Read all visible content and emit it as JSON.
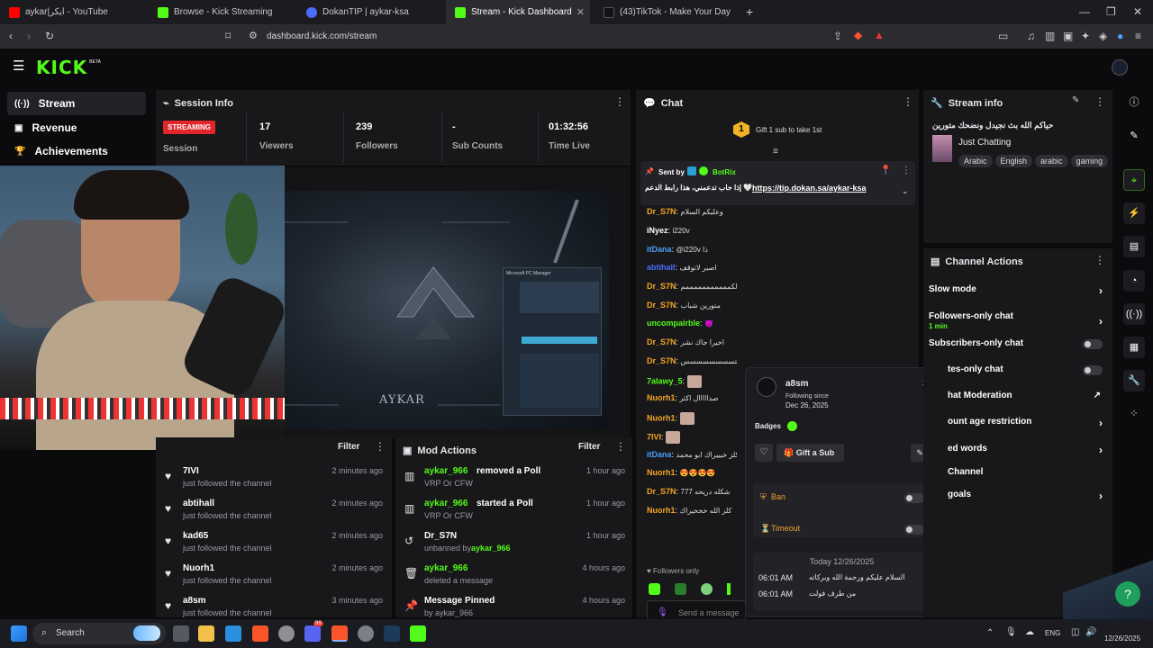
{
  "browser": {
    "tabs": [
      {
        "label": "aykar|ايكر - YouTube",
        "color": "#ff0000"
      },
      {
        "label": "Browse - Kick Streaming",
        "color": "#53fc18"
      },
      {
        "label": "DokanTIP | aykar-ksa",
        "color": "#4a6cf7"
      },
      {
        "label": "Stream - Kick Dashboard",
        "color": "#53fc18"
      },
      {
        "label": "(43)TikTok - Make Your Day",
        "color": "#111111"
      }
    ],
    "new_tab": "+",
    "url": "dashboard.kick.com/stream"
  },
  "brand": {
    "logo": "KICK",
    "badge": "BETA",
    "accent": "#53fc18"
  },
  "nav": [
    {
      "label": "Stream",
      "icon": "stream-icon"
    },
    {
      "label": "Revenue",
      "icon": "revenue-icon"
    },
    {
      "label": "Achievements",
      "icon": "trophy-icon"
    }
  ],
  "session": {
    "title": "Session Info",
    "status": "STREAMING",
    "status_label": "Session",
    "stats": [
      {
        "value": "17",
        "label": "Viewers"
      },
      {
        "value": "239",
        "label": "Followers"
      },
      {
        "value": "-",
        "label": "Sub Counts"
      },
      {
        "value": "01:32:56",
        "label": "Time Live"
      }
    ]
  },
  "preview": {
    "watermark": "AYKAR",
    "window_title": "Microsoft PC Manager"
  },
  "activity": {
    "filter": "Filter",
    "events": [
      {
        "name": "7IVI",
        "sub": "just followed the channel",
        "time": "2 minutes ago"
      },
      {
        "name": "abtihall",
        "sub": "just followed the channel",
        "time": "2 minutes ago"
      },
      {
        "name": "kad65",
        "sub": "just followed the channel",
        "time": "2 minutes ago"
      },
      {
        "name": "Nuorh1",
        "sub": "just followed the channel",
        "time": "2 minutes ago"
      },
      {
        "name": "a8sm",
        "sub": "just followed the channel",
        "time": "3 minutes ago"
      }
    ]
  },
  "mod_actions": {
    "title": "Mod Actions",
    "filter": "Filter",
    "items": [
      {
        "user": "aykar_966",
        "action": "removed a Poll",
        "sub": "VRP Or CFW",
        "time": "1 hour ago"
      },
      {
        "user": "aykar_966",
        "action": "started a Poll",
        "sub": "VRP Or CFW",
        "time": "1 hour ago"
      },
      {
        "user": "Dr_S7N",
        "action": "",
        "sub": "unbanned by",
        "by": "aykar_966",
        "time": "1 hour ago"
      },
      {
        "user": "aykar_966",
        "action": "",
        "sub": "deleted a message",
        "time": "4 hours ago"
      },
      {
        "user": "Message Pinned",
        "action": "",
        "sub": "by aykar_966",
        "time": "4 hours ago"
      }
    ]
  },
  "chat": {
    "title": "Chat",
    "gift_rank": "1",
    "gift_text": "Gift 1 sub to take 1st",
    "pinned_sender_prefix": "Sent by",
    "pinned_sender": "BotRix",
    "pinned_text": "إذا حاب تدعمني، هذا رابط الدعم 🤍",
    "pinned_link": "https://tip.dokan.sa/aykar-ksa",
    "messages": [
      {
        "user": "Dr_S7N",
        "text": "وعليكم السلام",
        "color": "#f5a623"
      },
      {
        "user": "iNyez",
        "text": "i220v",
        "color": "#ffffff"
      },
      {
        "user": "itDana",
        "text": "@i220v ذا",
        "color": "#4a9ff5"
      },
      {
        "user": "abtihall",
        "text": "اصبر لاتوقف",
        "color": "#4a6cf7"
      },
      {
        "user": "Dr_S7N",
        "text": "والكمممممممممممم",
        "color": "#f5a623"
      },
      {
        "user": "Dr_S7N",
        "text": "متورين شباب",
        "color": "#f5a623"
      },
      {
        "user": "uncompairble",
        "text": "😈",
        "color": "#53fc18"
      },
      {
        "user": "Dr_S7N",
        "text": "اخيرا جاك نشر",
        "color": "#f5a623"
      },
      {
        "user": "Dr_S7N",
        "text": "دوبيتسسسسسسسس",
        "color": "#f5a623"
      },
      {
        "user": "7alawy_5",
        "text": "",
        "color": "#53fc18"
      },
      {
        "user": "Nuorh1",
        "text": "صدااااال اكثر",
        "color": "#f5a623"
      },
      {
        "user": "Nuorh1",
        "text": "",
        "color": "#f5a623"
      },
      {
        "user": "7IVI",
        "text": "",
        "color": "#f5a623"
      },
      {
        "user": "itDana",
        "text": "كلز خبييراك ابو محمد",
        "color": "#4a9ff5"
      },
      {
        "user": "Nuorh1",
        "text": "😍😍😍😍",
        "color": "#f5a623"
      },
      {
        "user": "Dr_S7N",
        "text": "777 شكله دريحه",
        "color": "#f5a623"
      },
      {
        "user": "Nuorh1",
        "text": "كلز الله خخخيراك",
        "color": "#f5a623"
      }
    ],
    "followers_only": "Followers only",
    "placeholder": "Send a message",
    "count": "0"
  },
  "user_card": {
    "username": "a8sm",
    "following_since_label": "Following since",
    "following_since": "Dec 26, 2025",
    "badges_label": "Badges",
    "gift_button": "Gift a Sub",
    "ban": "Ban",
    "timeout": "Timeout",
    "date_header": "Today 12/26/2025",
    "history": [
      {
        "time": "06:01 AM",
        "text": "السلام عليكم ورحمة الله وبركاته"
      },
      {
        "time": "06:01 AM",
        "text": "من طرف فولت"
      }
    ]
  },
  "stream_info": {
    "title": "Stream info",
    "stream_title": "حياكم الله بث نجيدل ونضحك متورين",
    "category": "Just Chatting",
    "tags": [
      "Arabic",
      "English",
      "arabic",
      "gaming"
    ]
  },
  "channel_actions": {
    "title": "Channel Actions",
    "items": [
      {
        "label": "Slow mode",
        "sub": "",
        "control": "arrow"
      },
      {
        "label": "Followers-only chat",
        "sub": "1 min",
        "control": "arrow"
      },
      {
        "label": "Subscribers-only chat",
        "sub": "",
        "control": "toggle"
      },
      {
        "label": "tes-only chat",
        "sub": "",
        "control": "toggle"
      },
      {
        "label": "hat Moderation",
        "sub": "",
        "control": "external"
      },
      {
        "label": "ount age restriction",
        "sub": "",
        "control": "arrow"
      },
      {
        "label": "ed words",
        "sub": "",
        "control": "arrow"
      },
      {
        "label": "Channel",
        "sub": "",
        "control": "none"
      },
      {
        "label": "goals",
        "sub": "",
        "control": "arrow"
      }
    ]
  },
  "taskbar": {
    "search": "Search",
    "lang": "ENG",
    "date": "12/26/2025",
    "notif_badge": "99"
  }
}
